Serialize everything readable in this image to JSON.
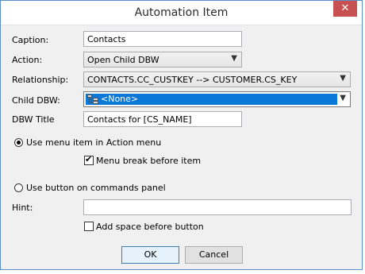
{
  "window": {
    "title": "Automation Item",
    "close_glyph": "✕"
  },
  "fields": {
    "caption": {
      "label": "Caption:",
      "value": "Contacts"
    },
    "action": {
      "label": "Action:",
      "value": "Open Child DBW"
    },
    "relationship": {
      "label": "Relationship:",
      "value": "CONTACTS.CC_CUSTKEY --> CUSTOMER.CS_KEY"
    },
    "child_dbw": {
      "label": "Child DBW:",
      "value": "<None>"
    },
    "dbw_title": {
      "label": "DBW Title",
      "value": "Contacts for [CS_NAME]"
    },
    "hint": {
      "label": "Hint:",
      "value": ""
    }
  },
  "options": {
    "menu_item": {
      "label": "Use menu item in Action menu",
      "selected": true
    },
    "menu_break": {
      "label": "Menu break before item",
      "checked": true
    },
    "button_panel": {
      "label": "Use button on commands panel",
      "selected": false
    },
    "add_space": {
      "label": "Add space before button",
      "checked": false
    }
  },
  "buttons": {
    "ok": "OK",
    "cancel": "Cancel"
  },
  "colors": {
    "selection": "#0a78d7",
    "close": "#c75050",
    "border": "#5b8fc7"
  }
}
